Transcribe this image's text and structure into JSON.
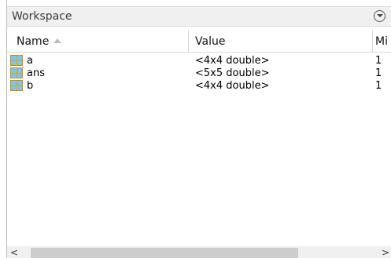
{
  "panel": {
    "title": "Workspace",
    "menu_icon": "chevron-down-circle-icon"
  },
  "columns": [
    {
      "label": "Name",
      "sorted": "ascending"
    },
    {
      "label": "Value"
    },
    {
      "label": "Mi"
    }
  ],
  "variables": [
    {
      "name": "a",
      "value": "<4x4 double>",
      "min": "1",
      "icon": "matrix-icon"
    },
    {
      "name": "ans",
      "value": "<5x5 double>",
      "min": "1",
      "icon": "matrix-icon"
    },
    {
      "name": "b",
      "value": "<4x4 double>",
      "min": "1",
      "icon": "matrix-icon"
    }
  ],
  "scrollbar": {
    "left_arrow": "<",
    "right_arrow": ">"
  },
  "colors": {
    "icon_fill": "#7fc4ef",
    "icon_grid": "#e5a000"
  }
}
